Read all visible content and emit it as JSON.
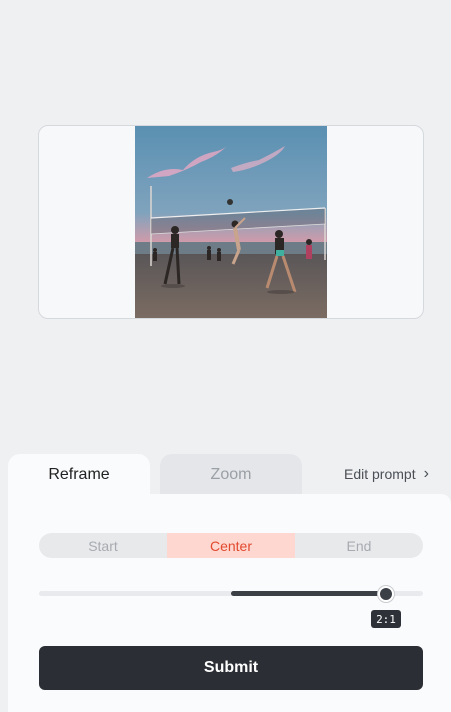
{
  "preview": {
    "image_subject": "beach-volleyball-sunset-photo"
  },
  "tabs": [
    {
      "label": "Reframe",
      "active": true
    },
    {
      "label": "Zoom",
      "active": false
    }
  ],
  "edit_prompt": {
    "label": "Edit prompt",
    "icon": "chevron-right-icon"
  },
  "position_options": [
    {
      "label": "Start",
      "active": false
    },
    {
      "label": "Center",
      "active": true
    },
    {
      "label": "End",
      "active": false
    }
  ],
  "slider": {
    "value_label": "2:1",
    "fill_fraction": 0.4
  },
  "submit": {
    "label": "Submit"
  },
  "colors": {
    "background": "#eff0f2",
    "accent": "#e2492f",
    "accent_bg": "#fdd7d0",
    "dark": "#2b2e34"
  }
}
